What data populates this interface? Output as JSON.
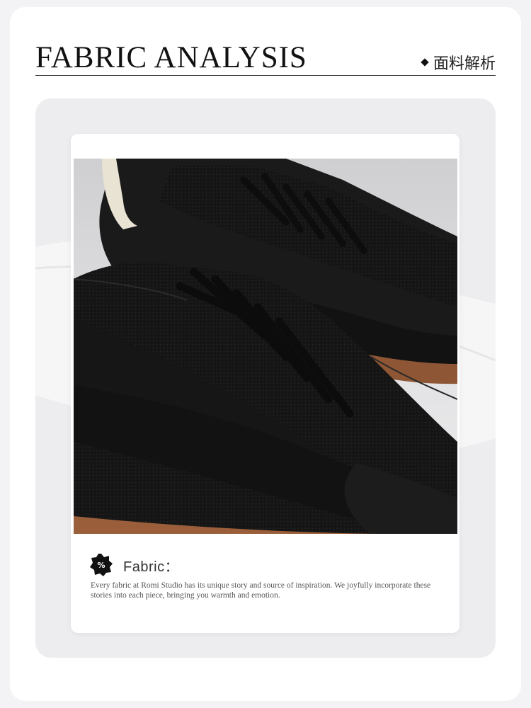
{
  "header": {
    "title": "FABRIC ANALYSIS",
    "subtitle": "面料解析"
  },
  "card": {
    "photo_name": "black-mesh-leather-sneakers",
    "fabric_label": "Fabric：",
    "fabric_description": "Every fabric at Romi Studio has its unique story and source of inspiration. We joyfully incorporate these stories into each piece, bringing you warmth and emotion."
  },
  "colors": {
    "background": "#f3f3f6",
    "stage": "#ededf0",
    "shoe_black": "#141414",
    "sole_brown": "#9a5f3a",
    "heel_cream": "#ece6d6"
  },
  "icons": {
    "bullet": "diamond-icon",
    "fabric": "fabric-badge-icon"
  }
}
